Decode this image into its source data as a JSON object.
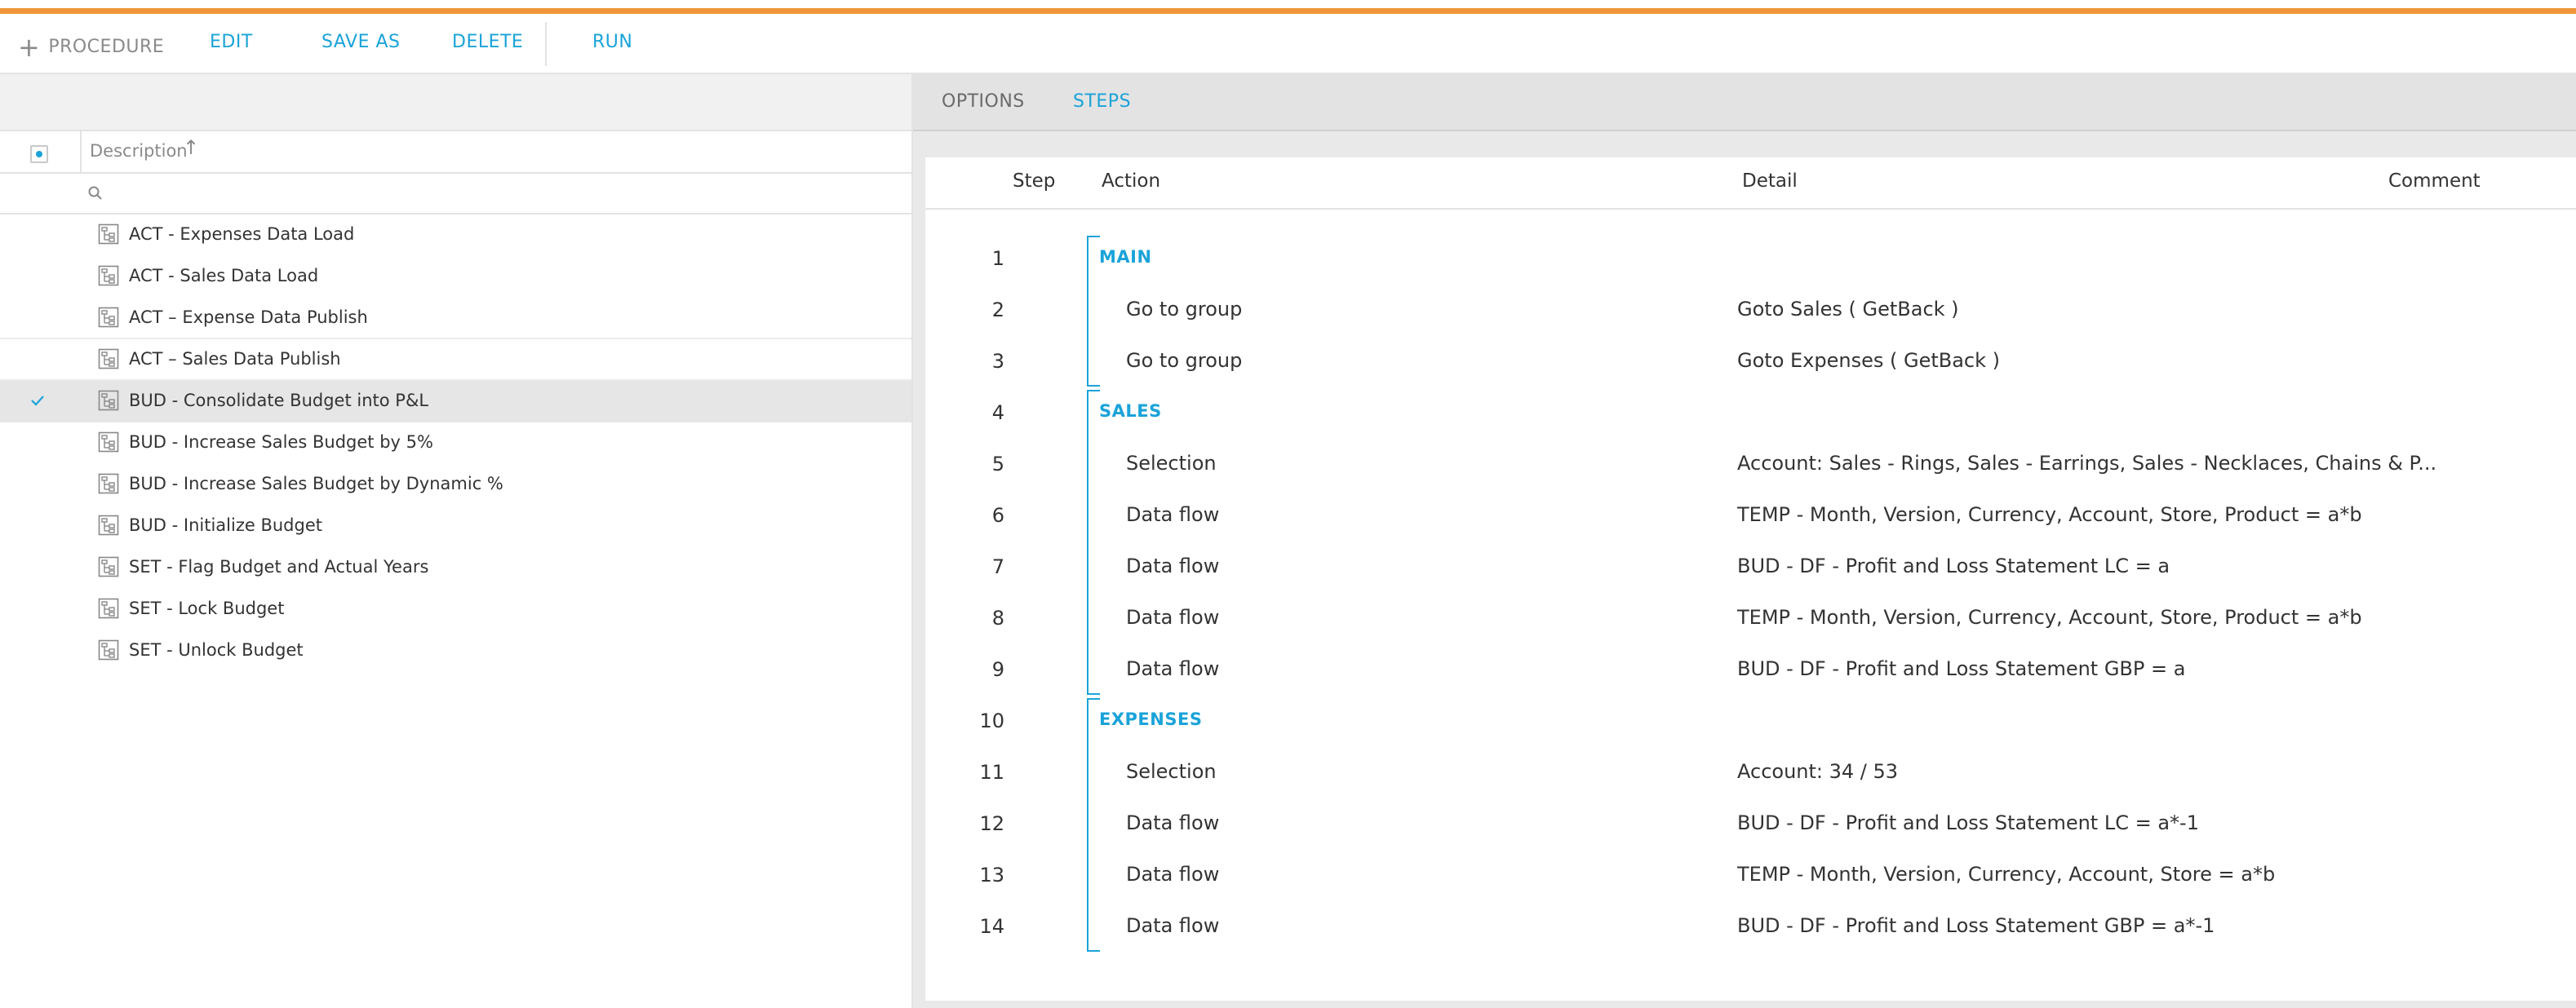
{
  "toolbar": {
    "procedure_label": "PROCEDURE",
    "edit_label": "EDIT",
    "save_as_label": "SAVE AS",
    "delete_label": "DELETE",
    "run_label": "RUN"
  },
  "list": {
    "column_header": "Description",
    "sort_direction": "ascending",
    "items": [
      {
        "label": "ACT - Expenses Data Load",
        "selected": false
      },
      {
        "label": "ACT - Sales Data Load",
        "selected": false
      },
      {
        "label": "ACT – Expense Data Publish",
        "selected": false
      },
      {
        "label": "ACT – Sales Data Publish",
        "selected": false
      },
      {
        "label": "BUD - Consolidate Budget into P&L",
        "selected": true
      },
      {
        "label": "BUD - Increase Sales Budget by 5%",
        "selected": false
      },
      {
        "label": "BUD - Increase Sales Budget by Dynamic %",
        "selected": false
      },
      {
        "label": "BUD - Initialize Budget",
        "selected": false
      },
      {
        "label": "SET - Flag Budget and Actual Years",
        "selected": false
      },
      {
        "label": "SET - Lock Budget",
        "selected": false
      },
      {
        "label": "SET - Unlock Budget",
        "selected": false
      }
    ]
  },
  "tabs": {
    "options_label": "OPTIONS",
    "steps_label": "STEPS",
    "active": "STEPS"
  },
  "steps": {
    "headers": {
      "step": "Step",
      "action": "Action",
      "detail": "Detail",
      "comment": "Comment"
    },
    "rows": [
      {
        "step": "1",
        "group": "MAIN"
      },
      {
        "step": "2",
        "action": "Go to group",
        "detail": "Goto Sales ( GetBack )"
      },
      {
        "step": "3",
        "action": "Go to group",
        "detail": "Goto Expenses ( GetBack )"
      },
      {
        "step": "4",
        "group": "SALES"
      },
      {
        "step": "5",
        "action": "Selection",
        "detail": "Account: Sales - Rings, Sales - Earrings, Sales - Necklaces, Chains & P..."
      },
      {
        "step": "6",
        "action": "Data flow",
        "detail": "TEMP - Month, Version, Currency, Account, Store, Product = a*b"
      },
      {
        "step": "7",
        "action": "Data flow",
        "detail": "BUD - DF - Profit and Loss Statement LC = a"
      },
      {
        "step": "8",
        "action": "Data flow",
        "detail": "TEMP - Month, Version, Currency, Account, Store, Product = a*b"
      },
      {
        "step": "9",
        "action": "Data flow",
        "detail": "BUD - DF - Profit and Loss Statement GBP = a"
      },
      {
        "step": "10",
        "group": "EXPENSES"
      },
      {
        "step": "11",
        "action": "Selection",
        "detail": "Account: 34 / 53"
      },
      {
        "step": "12",
        "action": "Data flow",
        "detail": "BUD - DF - Profit and Loss Statement LC = a*-1"
      },
      {
        "step": "13",
        "action": "Data flow",
        "detail": "TEMP - Month, Version, Currency, Account, Store = a*b"
      },
      {
        "step": "14",
        "action": "Data flow",
        "detail": "BUD - DF - Profit and Loss Statement GBP = a*-1"
      }
    ]
  },
  "colors": {
    "accent_orange": "#f0963c",
    "accent_blue": "#1aa3d9",
    "selected_row": "#e6e6e6"
  }
}
